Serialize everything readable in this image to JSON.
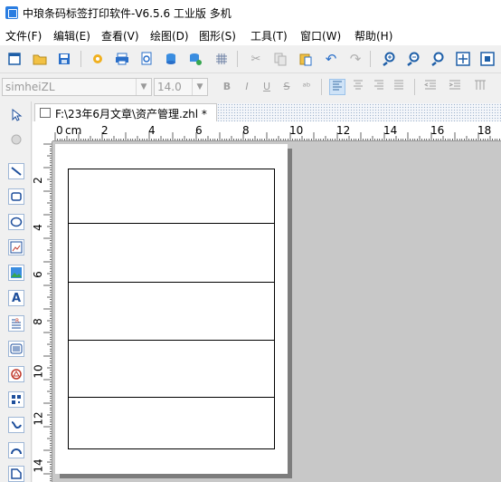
{
  "window": {
    "title": "中琅条码标签打印软件-V6.5.6 工业版 多机"
  },
  "menu": [
    "文件(F)",
    "编辑(E)",
    "查看(V)",
    "绘图(D)",
    "图形(S)",
    "工具(T)",
    "窗口(W)",
    "帮助(H)"
  ],
  "toolbar1": {
    "icons": [
      "new-file-icon",
      "open-folder-icon",
      "save-icon",
      "settings-icon",
      "print-icon",
      "print-preview-icon",
      "database-icon",
      "database-settings-icon",
      "grid-icon",
      "cut-icon",
      "copy-icon",
      "paste-icon",
      "undo-icon",
      "redo-icon",
      "zoom-in-icon",
      "zoom-out-icon",
      "zoom-fit-icon",
      "zoom-page-icon",
      "zoom-all-icon"
    ]
  },
  "format": {
    "font_family": "simheiZL",
    "font_size": "14.0",
    "bold": "B",
    "italic": "I",
    "underline": "U",
    "strike": "S"
  },
  "document": {
    "tab_label": "F:\\23年6月文章\\资产管理.zhl *"
  },
  "ruler": {
    "unit": "cm",
    "top_labels": [
      "0",
      "2",
      "4",
      "6",
      "8",
      "10",
      "12",
      "14",
      "16",
      "18"
    ],
    "left_labels": [
      "2",
      "4",
      "6",
      "8",
      "10",
      "12",
      "14"
    ]
  },
  "colors": {
    "accent": "#2a7de1",
    "canvas": "#c8c8c8",
    "page": "#ffffff"
  }
}
